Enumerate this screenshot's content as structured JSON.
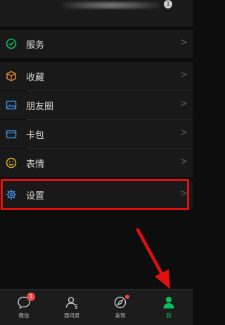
{
  "menu": {
    "items": [
      {
        "label": "服务",
        "icon": "wechat-pay-icon"
      },
      {
        "label": "收藏",
        "icon": "cube-icon"
      },
      {
        "label": "朋友圈",
        "icon": "photo-icon"
      },
      {
        "label": "卡包",
        "icon": "wallet-icon"
      },
      {
        "label": "表情",
        "icon": "smiley-icon"
      },
      {
        "label": "设置",
        "icon": "gear-icon"
      }
    ],
    "chevron": ">"
  },
  "header": {
    "badge": "1"
  },
  "tabbar": {
    "tabs": [
      {
        "label": "微信",
        "icon": "chat-bubble-icon",
        "badge": "1"
      },
      {
        "label": "通讯录",
        "icon": "contacts-icon"
      },
      {
        "label": "发现",
        "icon": "compass-icon"
      },
      {
        "label": "我",
        "icon": "person-icon",
        "active": true
      }
    ]
  },
  "colors": {
    "accent": "#07c160",
    "highlight": "#e01010",
    "badge": "#f04848"
  }
}
